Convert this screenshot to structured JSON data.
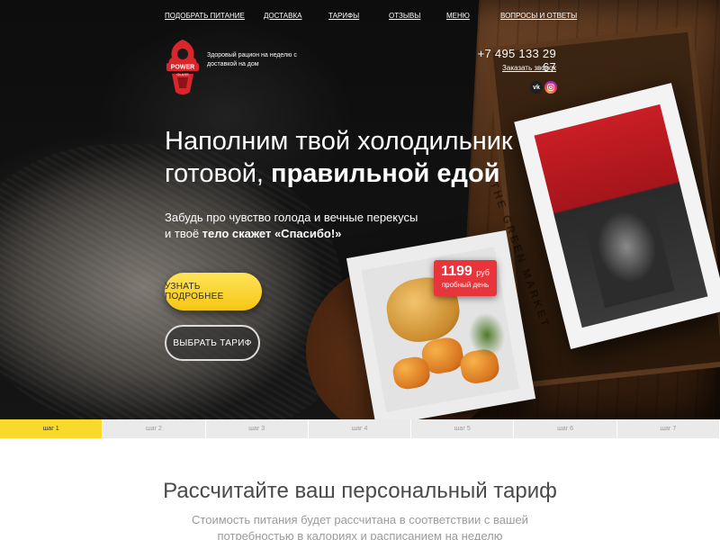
{
  "nav": {
    "items": [
      {
        "label": "ПОДОБРАТЬ ПИТАНИЕ"
      },
      {
        "label": "ДОСТАВКА"
      },
      {
        "label": "ТАРИФЫ"
      },
      {
        "label": "ОТЗЫВЫ"
      },
      {
        "label": "МЕНЮ"
      },
      {
        "label": "ВОПРОСЫ И ОТВЕТЫ"
      }
    ]
  },
  "logo": {
    "brand_line1": "POWER",
    "brand_line2": "GLASS",
    "tagline": "Здоровый рацион на неделю с доставкой на дом"
  },
  "contact": {
    "phone": "+7 495 133 29 67",
    "callback_label": "Заказать звонок",
    "vk_label": "vk"
  },
  "hero": {
    "headline_line1": "Наполним твой холодильник",
    "headline_line2_plain": "готовой, ",
    "headline_line2_bold": "правильной едой",
    "sub_line1": "Забудь про чувство голода и вечные перекусы",
    "sub_line2_plain": "и твоё ",
    "sub_line2_bold": "тело скажет «Спасибо!»",
    "crate_text": "THE GREEN MARKET"
  },
  "price_badge": {
    "amount": "1199",
    "currency": "руб",
    "note": "пробный день"
  },
  "buttons": {
    "more_label": "УЗНАТЬ ПОДРОБНЕЕ",
    "tariff_label": "ВЫБРАТЬ ТАРИФ"
  },
  "steps": [
    {
      "label": "шаг 1",
      "active": true
    },
    {
      "label": "шаг 2",
      "active": false
    },
    {
      "label": "шаг 3",
      "active": false
    },
    {
      "label": "шаг 4",
      "active": false
    },
    {
      "label": "шаг 5",
      "active": false
    },
    {
      "label": "шаг 6",
      "active": false
    },
    {
      "label": "шаг 7",
      "active": false
    }
  ],
  "calculator": {
    "title": "Рассчитайте ваш персональный тариф",
    "description": "Стоимость питания будет рассчитана в соответствии с вашей потребностью в калориях и расписанием на неделю"
  },
  "colors": {
    "accent_yellow": "#f8d92c",
    "badge_red": "#e8343b",
    "logo_red": "#d8262c"
  }
}
